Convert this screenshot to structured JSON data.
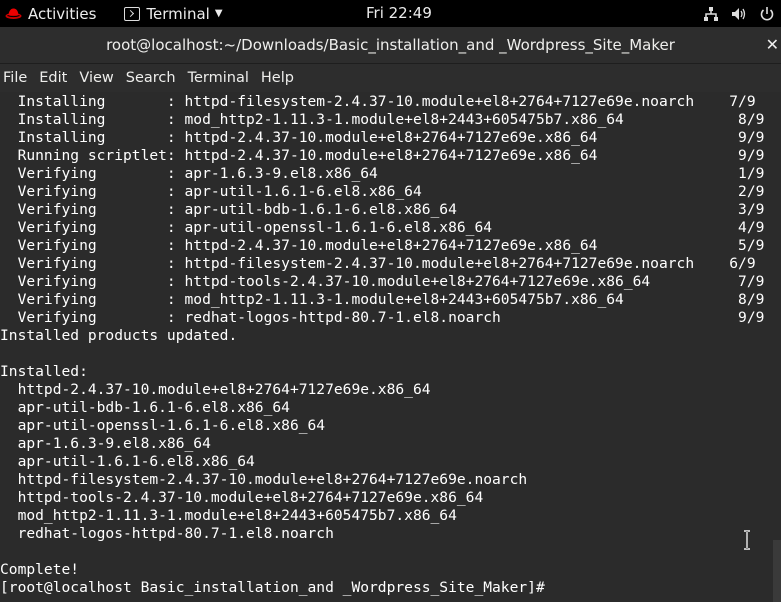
{
  "topbar": {
    "activities_label": "Activities",
    "app_menu_label": "Terminal",
    "clock": "Fri 22:49",
    "icons": [
      "network-icon",
      "volume-icon",
      "power-icon"
    ]
  },
  "window": {
    "title": "root@localhost:~/Downloads/Basic_installation_and _Wordpress_Site_Maker"
  },
  "menubar": {
    "items": [
      "File",
      "Edit",
      "View",
      "Search",
      "Terminal",
      "Help"
    ]
  },
  "terminal": {
    "lines": [
      "  Installing       : httpd-filesystem-2.4.37-10.module+el8+2764+7127e69e.noarch    7/9",
      "  Installing       : mod_http2-1.11.3-1.module+el8+2443+605475b7.x86_64             8/9",
      "  Installing       : httpd-2.4.37-10.module+el8+2764+7127e69e.x86_64                9/9",
      "  Running scriptlet: httpd-2.4.37-10.module+el8+2764+7127e69e.x86_64                9/9",
      "  Verifying        : apr-1.6.3-9.el8.x86_64                                         1/9",
      "  Verifying        : apr-util-1.6.1-6.el8.x86_64                                    2/9",
      "  Verifying        : apr-util-bdb-1.6.1-6.el8.x86_64                                3/9",
      "  Verifying        : apr-util-openssl-1.6.1-6.el8.x86_64                            4/9",
      "  Verifying        : httpd-2.4.37-10.module+el8+2764+7127e69e.x86_64                5/9",
      "  Verifying        : httpd-filesystem-2.4.37-10.module+el8+2764+7127e69e.noarch    6/9",
      "  Verifying        : httpd-tools-2.4.37-10.module+el8+2764+7127e69e.x86_64          7/9",
      "  Verifying        : mod_http2-1.11.3-1.module+el8+2443+605475b7.x86_64             8/9",
      "  Verifying        : redhat-logos-httpd-80.7-1.el8.noarch                           9/9",
      "Installed products updated.",
      "",
      "Installed:",
      "  httpd-2.4.37-10.module+el8+2764+7127e69e.x86_64",
      "  apr-util-bdb-1.6.1-6.el8.x86_64",
      "  apr-util-openssl-1.6.1-6.el8.x86_64",
      "  apr-1.6.3-9.el8.x86_64",
      "  apr-util-1.6.1-6.el8.x86_64",
      "  httpd-filesystem-2.4.37-10.module+el8+2764+7127e69e.noarch",
      "  httpd-tools-2.4.37-10.module+el8+2764+7127e69e.x86_64",
      "  mod_http2-1.11.3-1.module+el8+2443+605475b7.x86_64",
      "  redhat-logos-httpd-80.7-1.el8.noarch",
      "",
      "Complete!",
      "[root@localhost Basic_installation_and _Wordpress_Site_Maker]# "
    ]
  },
  "colors": {
    "topbar_bg": "#000000",
    "window_bg": "#2d2d2d",
    "terminal_bg": "#2b2b2b",
    "terminal_fg": "#ffffff",
    "logo_red": "#ee0000"
  }
}
